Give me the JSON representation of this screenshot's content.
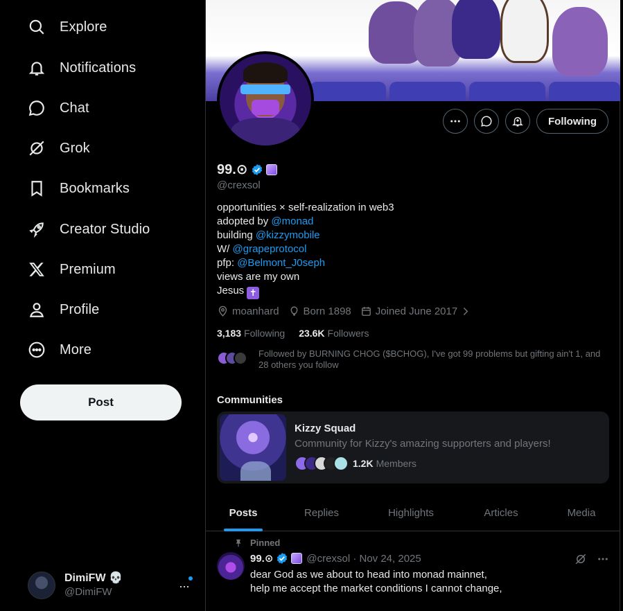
{
  "sidebar": {
    "items": [
      {
        "label": "Explore",
        "icon": "search-icon"
      },
      {
        "label": "Notifications",
        "icon": "bell-icon"
      },
      {
        "label": "Chat",
        "icon": "chat-bubble-icon"
      },
      {
        "label": "Grok",
        "icon": "grok-icon"
      },
      {
        "label": "Bookmarks",
        "icon": "bookmark-icon"
      },
      {
        "label": "Creator Studio",
        "icon": "rocket-icon"
      },
      {
        "label": "Premium",
        "icon": "x-logo-icon"
      },
      {
        "label": "Profile",
        "icon": "person-icon"
      },
      {
        "label": "More",
        "icon": "more-circle-icon"
      }
    ],
    "post_label": "Post",
    "account": {
      "name": "DimiFW 💀",
      "handle": "@DimiFW",
      "more": "···"
    }
  },
  "profile": {
    "name": "99.⊙",
    "handle": "@crexsol",
    "bio": {
      "l1": "opportunities × self-realization in web3",
      "l2_prefix": "adopted by ",
      "l2_link": "@monad",
      "l3_prefix": "building ",
      "l3_link": "@kizzymobile",
      "l4_prefix": "W/ ",
      "l4_link": "@grapeprotocol",
      "l5_prefix": "pfp: ",
      "l5_link": "@Belmont_J0seph",
      "l6": "views are my own",
      "l7_prefix": "Jesus ",
      "l7_emoji": "✝"
    },
    "location": "moanhard",
    "born": "Born 1898",
    "joined": "Joined June 2017",
    "following_count": "3,183",
    "following_label": "Following",
    "followers_count": "23.6K",
    "followers_label": "Followers",
    "followed_by": "Followed by BURNING CHOG ($BCHOG), I've got 99 problems but gifting ain't 1, and 28 others you follow",
    "follow_button": "Following"
  },
  "communities": {
    "title": "Communities",
    "card": {
      "name": "Kizzy Squad",
      "description": "Community for Kizzy's amazing supporters and players!",
      "members_count": "1.2K",
      "members_label": "Members"
    }
  },
  "tabs": [
    "Posts",
    "Replies",
    "Highlights",
    "Articles",
    "Media"
  ],
  "post": {
    "pinned_label": "Pinned",
    "name": "99.⊙",
    "handle_date": "@crexsol · Nov 24, 2025",
    "line1": "dear God as we about to head into monad mainnet,",
    "line2": "help me accept the market conditions I cannot change,"
  },
  "colors": {
    "accent": "#1d9bf0",
    "background": "#000000",
    "text": "#e7e9ea",
    "muted": "#71767b"
  }
}
